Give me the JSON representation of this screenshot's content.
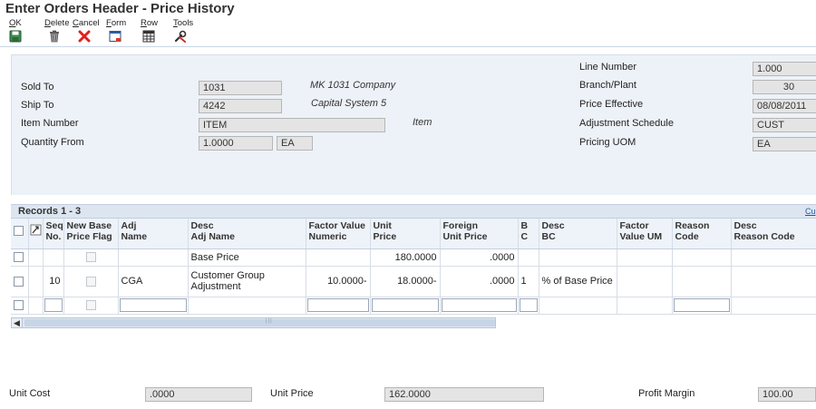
{
  "window": {
    "title": "Enter Orders Header - Price History"
  },
  "toolbar": {
    "ok": "OK",
    "delete": "Delete",
    "cancel": "Cancel",
    "form": "Form",
    "row": "Row",
    "tools": "Tools"
  },
  "header": {
    "sold_to": {
      "label": "Sold To",
      "value": "1031",
      "desc": "MK 1031 Company"
    },
    "ship_to": {
      "label": "Ship To",
      "value": "4242",
      "desc": "Capital System 5"
    },
    "item_number": {
      "label": "Item Number",
      "value": "ITEM",
      "desc": "Item"
    },
    "quantity_from": {
      "label": "Quantity From",
      "value": "1.0000",
      "uom": "EA"
    },
    "line_number": {
      "label": "Line Number",
      "value": "1.000"
    },
    "branch_plant": {
      "label": "Branch/Plant",
      "value": "30"
    },
    "price_effective": {
      "label": "Price Effective",
      "value": "08/08/2011"
    },
    "adjustment_schedule": {
      "label": "Adjustment Schedule",
      "value": "CUST"
    },
    "pricing_uom": {
      "label": "Pricing UOM",
      "value": "EA"
    }
  },
  "grid": {
    "records_label": "Records 1 - 3",
    "customize_link": "Cu",
    "columns": {
      "seq": [
        "Seq",
        "No."
      ],
      "new_base": [
        "New Base",
        "Price Flag"
      ],
      "adj": [
        "Adj",
        "Name"
      ],
      "desc_adj": [
        "Desc",
        "Adj Name"
      ],
      "factor_num": [
        "Factor Value",
        "Numeric"
      ],
      "unit_price": [
        "Unit",
        "Price"
      ],
      "foreign": [
        "Foreign",
        "Unit Price"
      ],
      "bc": [
        "B",
        "C"
      ],
      "desc_bc": [
        "Desc",
        "BC"
      ],
      "factor_um": [
        "Factor",
        "Value UM"
      ],
      "reason": [
        "Reason",
        "Code"
      ],
      "desc_reason": [
        "Desc",
        "Reason Code"
      ]
    },
    "rows": [
      {
        "seq": "",
        "adj": "",
        "desc": "Base Price",
        "factor": "",
        "unit_price": "180.0000",
        "foreign": ".0000",
        "bc": "",
        "desc_bc": "",
        "factor_um": "",
        "reason": "",
        "desc_reason": ""
      },
      {
        "seq": "10",
        "adj": "CGA",
        "desc": "Customer Group Adjustment",
        "factor": "10.0000-",
        "unit_price": "18.0000-",
        "foreign": ".0000",
        "bc": "1",
        "desc_bc": "% of Base Price",
        "factor_um": "",
        "reason": "",
        "desc_reason": ""
      }
    ]
  },
  "footer": {
    "unit_cost": {
      "label": "Unit Cost",
      "value": ".0000"
    },
    "unit_price": {
      "label": "Unit Price",
      "value": "162.0000"
    },
    "profit_margin": {
      "label": "Profit Margin",
      "value": "100.00"
    }
  },
  "colors": {
    "header_bg": "#edf2f8",
    "field_bg": "#e4e4e4",
    "cancel_red": "#e0201b",
    "link_blue": "#1f5aa6"
  }
}
